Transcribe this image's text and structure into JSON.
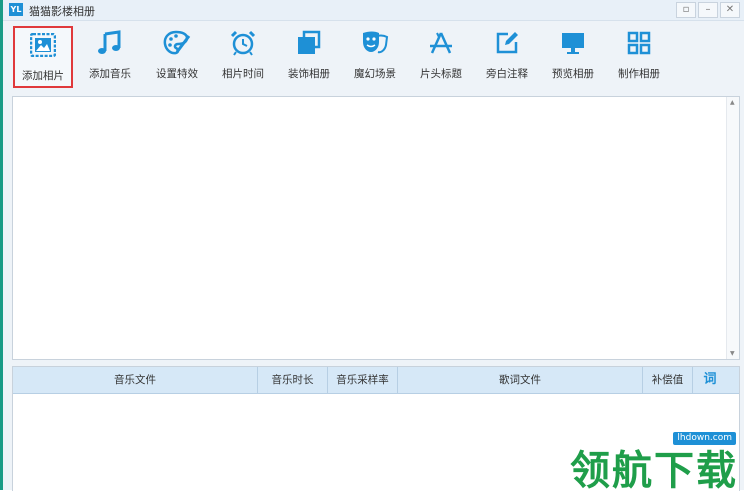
{
  "window": {
    "title": "猫猫影楼相册",
    "app_icon_text": "YL",
    "buttons": [
      "restore",
      "minimize",
      "close"
    ]
  },
  "toolbar": {
    "items": [
      {
        "label": "添加相片",
        "icon": "image-icon",
        "active": true
      },
      {
        "label": "添加音乐",
        "icon": "music-note-icon"
      },
      {
        "label": "设置特效",
        "icon": "palette-icon"
      },
      {
        "label": "相片时间",
        "icon": "alarm-clock-icon"
      },
      {
        "label": "装饰相册",
        "icon": "layers-icon"
      },
      {
        "label": "魔幻场景",
        "icon": "theater-masks-icon"
      },
      {
        "label": "片头标题",
        "icon": "app-store-icon"
      },
      {
        "label": "旁白注释",
        "icon": "edit-icon"
      },
      {
        "label": "预览相册",
        "icon": "monitor-icon"
      },
      {
        "label": "制作相册",
        "icon": "grid-icon"
      }
    ],
    "accent": "#1e90d6",
    "active_border": "#e0393b"
  },
  "music_table": {
    "columns": [
      "音乐文件",
      "音乐时长",
      "音乐采样率",
      "歌词文件",
      "补偿值",
      "词"
    ]
  },
  "watermark": {
    "url": "lhdown.com",
    "text": "领航下载",
    "color": "#1f9e4a"
  }
}
